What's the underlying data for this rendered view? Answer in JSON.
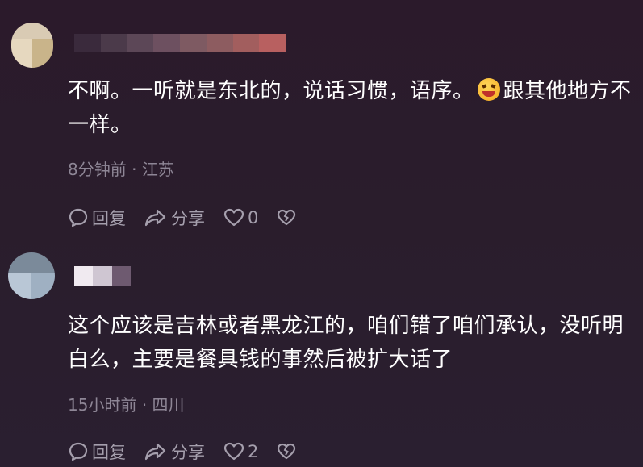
{
  "comments": [
    {
      "text": "不啊。一听就是东北的，说话习惯，语序。",
      "text_tail": "跟其他地方不一样。",
      "emoji": "grinning-face-emoji",
      "time": "8分钟前",
      "location": "江苏",
      "reply_label": "回复",
      "share_label": "分享",
      "like_count": "0"
    },
    {
      "text": "这个应该是吉林或者黑龙江的，咱们错了咱们承认，没听明白么，主要是餐具钱的事然后被扩大话了",
      "time": "15小时前",
      "location": "四川",
      "reply_label": "回复",
      "share_label": "分享",
      "like_count": "2"
    }
  ],
  "separator": "·",
  "colors": {
    "background": "#2a1d2c",
    "text": "#ffffff",
    "meta": "#8e8696",
    "action": "#a59fad"
  },
  "icons": [
    "reply-bubble-icon",
    "share-arrow-icon",
    "heart-icon",
    "dislike-broken-heart-icon"
  ]
}
